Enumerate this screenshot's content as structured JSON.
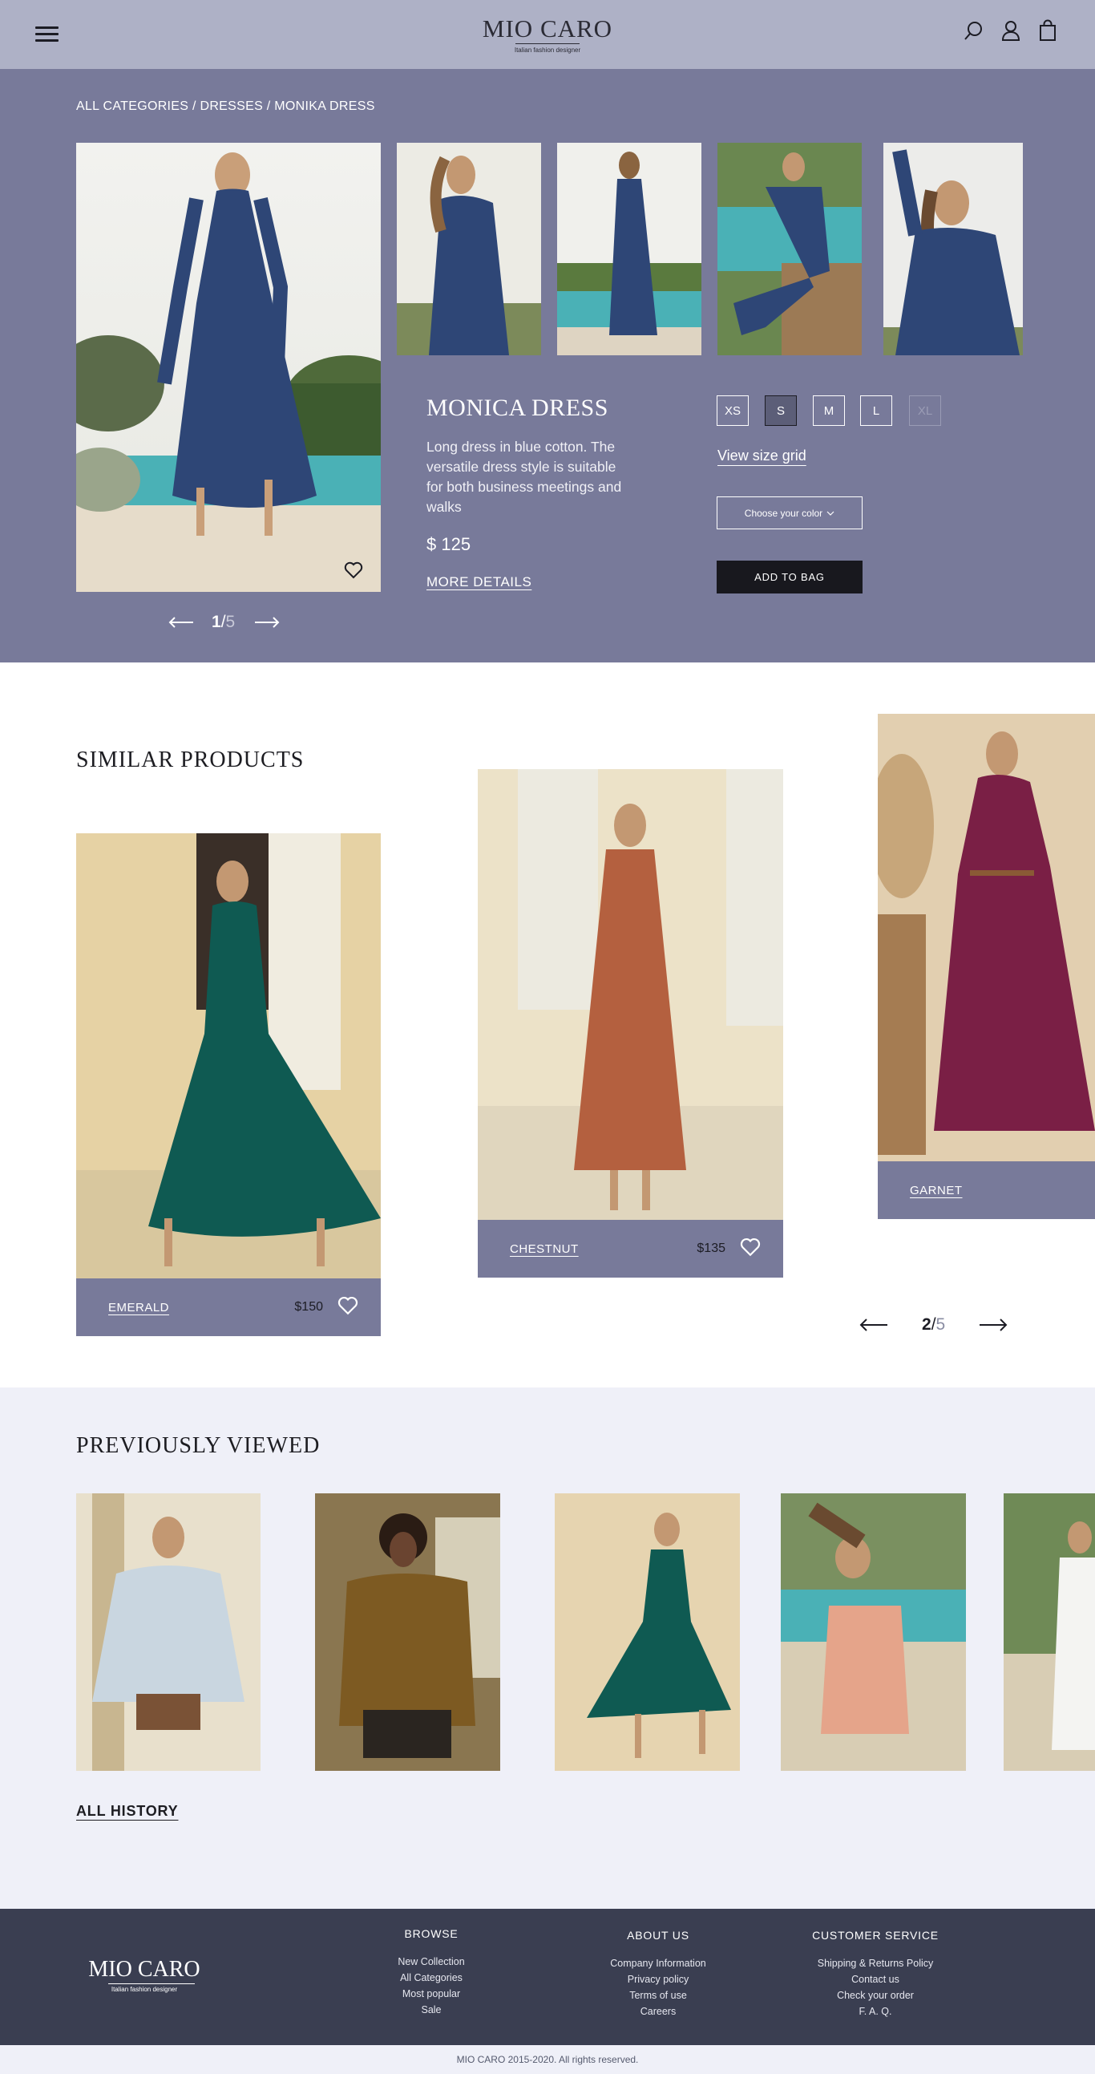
{
  "header": {
    "brand": "MIO CARO",
    "tagline": "Italian fashion designer",
    "icons": [
      "menu-icon",
      "search-icon",
      "user-icon",
      "bag-icon"
    ]
  },
  "product": {
    "breadcrumb": "ALL CATEGORIES / DRESSES / MONIKA DRESS",
    "title": "MONICA DRESS",
    "description": "Long dress in blue cotton. The versatile dress style is suitable for both business meetings and walks",
    "price": "$ 125",
    "more_details": "MORE DETAILS",
    "sizes": [
      {
        "label": "XS",
        "state": "available"
      },
      {
        "label": "S",
        "state": "selected"
      },
      {
        "label": "M",
        "state": "available"
      },
      {
        "label": "L",
        "state": "available"
      },
      {
        "label": "XL",
        "state": "unavailable"
      }
    ],
    "size_grid_link": "View size grid",
    "color_select_placeholder": "Choose your color",
    "add_to_bag": "ADD TO BAG",
    "gallery_pager": {
      "current": "1",
      "separator": "/",
      "total": "5"
    }
  },
  "similar": {
    "heading": "SIMILAR PRODUCTS",
    "items": [
      {
        "name": "EMERALD",
        "price": "$150",
        "color": "#0f5a52"
      },
      {
        "name": "CHESTNUT",
        "price": "$135",
        "color": "#b4603f"
      },
      {
        "name": "GARNET",
        "price": "",
        "color": "#7a1f45"
      }
    ],
    "pager": {
      "current": "2",
      "separator": "/",
      "total": "5"
    }
  },
  "previously_viewed": {
    "heading": "PREVIOUSLY VIEWED",
    "all_history": "ALL HISTORY"
  },
  "footer": {
    "brand": "MIO CARO",
    "tagline": "Italian fashion designer",
    "columns": [
      {
        "heading": "BROWSE",
        "links": [
          "New Collection",
          "All Categories",
          "Most popular",
          "Sale"
        ]
      },
      {
        "heading": "ABOUT US",
        "links": [
          "Company Information",
          "Privacy policy",
          "Terms of use",
          "Careers"
        ]
      },
      {
        "heading": "CUSTOMER SERVICE",
        "links": [
          "Shipping & Returns Policy",
          "Contact us",
          "Check your order",
          "F. A. Q."
        ]
      }
    ],
    "copyright": "MIO CARO 2015-2020. All rights reserved."
  },
  "colors": {
    "header_bg": "#aeb1c6",
    "product_bg": "#787a9a",
    "dark": "#18181e",
    "light_section_bg": "#eff0f8",
    "footer_bg": "#3a3e51"
  }
}
